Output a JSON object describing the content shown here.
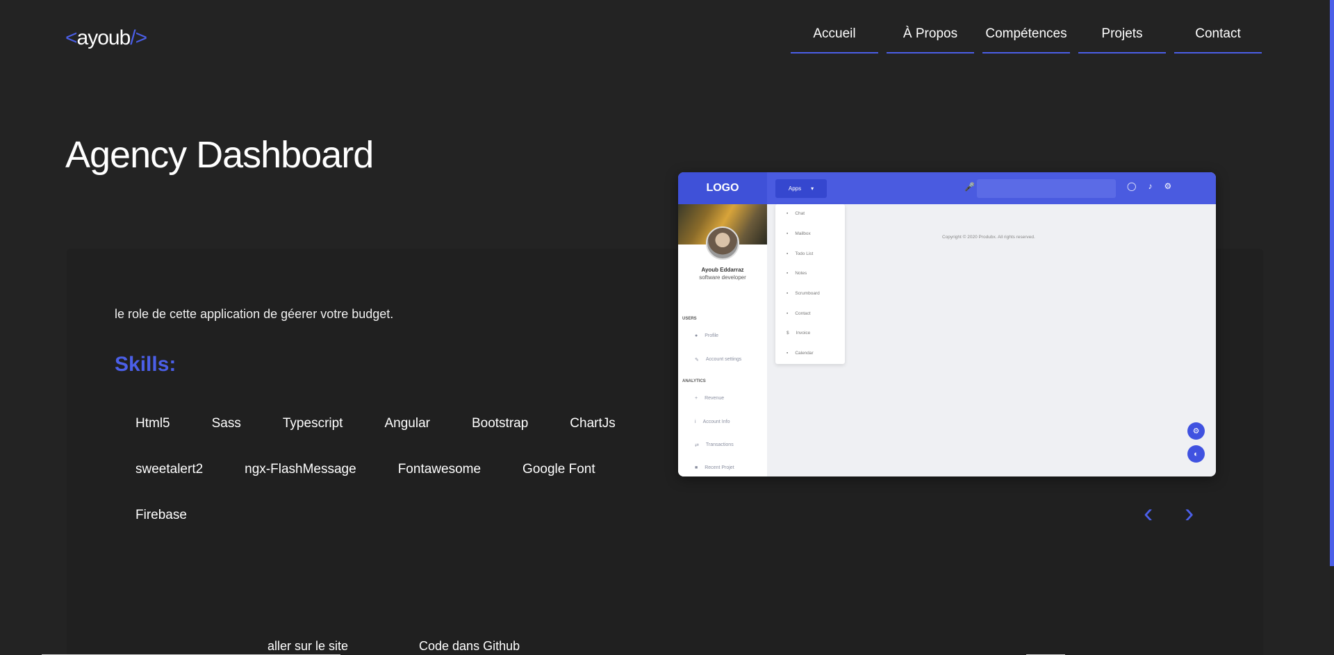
{
  "header": {
    "logo_left": "<",
    "logo_name": "ayoub",
    "logo_right": "/>",
    "nav": [
      "Accueil",
      "À Propos",
      "Compétences",
      "Projets",
      "Contact"
    ]
  },
  "project": {
    "title": "Agency Dashboard",
    "description": "le role de cette application de géerer votre budget.",
    "skills_title": "Skills:",
    "skills": [
      "Html5",
      "Sass",
      "Typescript",
      "Angular",
      "Bootstrap",
      "ChartJs",
      "sweetalert2",
      "ngx-FlashMessage",
      "Fontawesome",
      "Google Font",
      "Firebase"
    ],
    "link_site": "aller sur le site",
    "link_github": "Code dans Github"
  },
  "preview": {
    "logo": "LOGO",
    "apps_label": "Apps",
    "user_name": "Ayoub Eddarraz",
    "user_role": "software developer",
    "section_users": "USERS",
    "section_analytics": "ANALYTICS",
    "side_items": [
      "Profile",
      "Account settings",
      "Revenue",
      "Account Info",
      "Transactions",
      "Recent Projet"
    ],
    "menu_items": [
      "Chat",
      "Mailbox",
      "Todo List",
      "Notes",
      "Scrumboard",
      "Contact",
      "Invoice",
      "Calendar"
    ],
    "copyright": "Copyright © 2020 Produbx. All rights reserved."
  },
  "colors": {
    "accent": "#4b5fe8",
    "background": "#232323",
    "card": "#202020"
  }
}
